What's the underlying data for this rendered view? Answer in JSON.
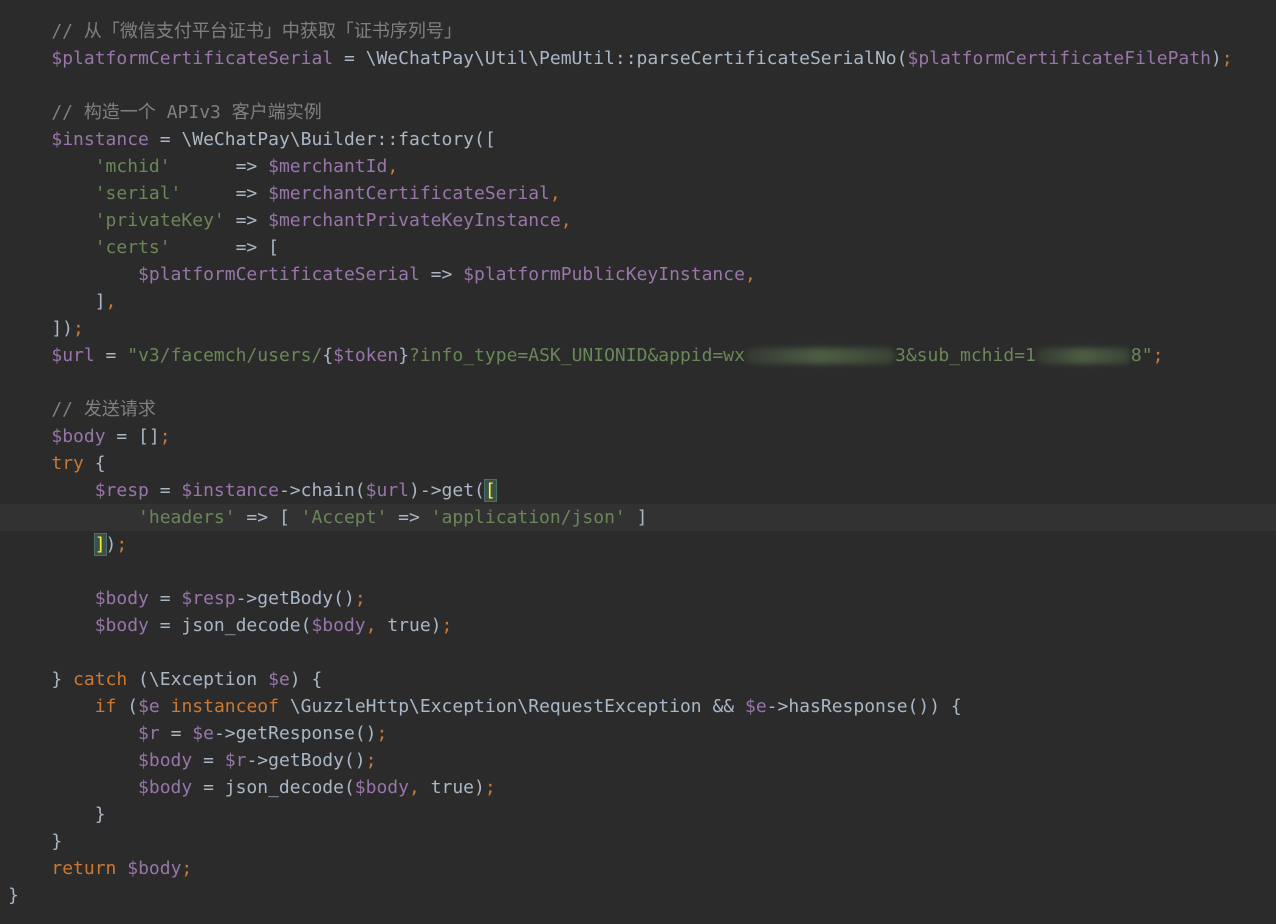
{
  "editor": {
    "theme_colors": {
      "background": "#2b2b2b",
      "current_line": "#323232",
      "comment": "#808080",
      "variable": "#9876aa",
      "string": "#6a8759",
      "keyword": "#cc7832",
      "plain": "#a9b7c6"
    },
    "current_line_index": 18,
    "lines": [
      [
        [
          "comment",
          "    // 从「微信支付平台证书」中获取「证书序列号」"
        ]
      ],
      [
        [
          "plain",
          "    "
        ],
        [
          "var",
          "$platformCertificateSerial"
        ],
        [
          "plain",
          " = \\WeChatPay\\Util\\PemUtil::parseCertificateSerialNo("
        ],
        [
          "var",
          "$platformCertificateFilePath"
        ],
        [
          "plain",
          ")"
        ],
        [
          "punct",
          ";"
        ]
      ],
      [],
      [
        [
          "comment",
          "    // 构造一个 APIv3 客户端实例"
        ]
      ],
      [
        [
          "plain",
          "    "
        ],
        [
          "var",
          "$instance"
        ],
        [
          "plain",
          " = \\WeChatPay\\Builder::factory(["
        ]
      ],
      [
        [
          "plain",
          "        "
        ],
        [
          "str",
          "'mchid'"
        ],
        [
          "plain",
          "      => "
        ],
        [
          "var",
          "$merchantId"
        ],
        [
          "punct",
          ","
        ]
      ],
      [
        [
          "plain",
          "        "
        ],
        [
          "str",
          "'serial'"
        ],
        [
          "plain",
          "     => "
        ],
        [
          "var",
          "$merchantCertificateSerial"
        ],
        [
          "punct",
          ","
        ]
      ],
      [
        [
          "plain",
          "        "
        ],
        [
          "str",
          "'privateKey'"
        ],
        [
          "plain",
          " => "
        ],
        [
          "var",
          "$merchantPrivateKeyInstance"
        ],
        [
          "punct",
          ","
        ]
      ],
      [
        [
          "plain",
          "        "
        ],
        [
          "str",
          "'certs'"
        ],
        [
          "plain",
          "      => ["
        ]
      ],
      [
        [
          "plain",
          "            "
        ],
        [
          "var",
          "$platformCertificateSerial"
        ],
        [
          "plain",
          " => "
        ],
        [
          "var",
          "$platformPublicKeyInstance"
        ],
        [
          "punct",
          ","
        ]
      ],
      [
        [
          "plain",
          "        ]"
        ],
        [
          "punct",
          ","
        ]
      ],
      [
        [
          "plain",
          "    ])"
        ],
        [
          "punct",
          ";"
        ]
      ],
      [
        [
          "plain",
          "    "
        ],
        [
          "var",
          "$url"
        ],
        [
          "plain",
          " = "
        ],
        [
          "str",
          "\"v3/facemch/users/"
        ],
        [
          "plain",
          "{"
        ],
        [
          "var",
          "$token"
        ],
        [
          "plain",
          "}"
        ],
        [
          "str",
          "?info_type=ASK_UNIONID&appid=wx"
        ],
        [
          "blur",
          "",
          150
        ],
        [
          "str",
          "3&sub_mchid=1"
        ],
        [
          "blur",
          "",
          95
        ],
        [
          "str",
          "8\""
        ],
        [
          "punct",
          ";"
        ]
      ],
      [],
      [
        [
          "comment",
          "    // 发送请求"
        ]
      ],
      [
        [
          "plain",
          "    "
        ],
        [
          "var",
          "$body"
        ],
        [
          "plain",
          " = []"
        ],
        [
          "punct",
          ";"
        ]
      ],
      [
        [
          "plain",
          "    "
        ],
        [
          "kw",
          "try"
        ],
        [
          "plain",
          " {"
        ]
      ],
      [
        [
          "plain",
          "        "
        ],
        [
          "var",
          "$resp"
        ],
        [
          "plain",
          " = "
        ],
        [
          "var",
          "$instance"
        ],
        [
          "plain",
          "->chain("
        ],
        [
          "var",
          "$url"
        ],
        [
          "plain",
          ")->get("
        ],
        [
          "match",
          "["
        ]
      ],
      [
        [
          "plain",
          "            "
        ],
        [
          "str",
          "'headers'"
        ],
        [
          "plain",
          " => [ "
        ],
        [
          "str",
          "'Accept'"
        ],
        [
          "plain",
          " => "
        ],
        [
          "str",
          "'application/json'"
        ],
        [
          "plain",
          " ]"
        ]
      ],
      [
        [
          "plain",
          "        "
        ],
        [
          "match",
          "]"
        ],
        [
          "plain",
          ")"
        ],
        [
          "punct",
          ";"
        ]
      ],
      [],
      [
        [
          "plain",
          "        "
        ],
        [
          "var",
          "$body"
        ],
        [
          "plain",
          " = "
        ],
        [
          "var",
          "$resp"
        ],
        [
          "plain",
          "->getBody()"
        ],
        [
          "punct",
          ";"
        ]
      ],
      [
        [
          "plain",
          "        "
        ],
        [
          "var",
          "$body"
        ],
        [
          "plain",
          " = json_decode("
        ],
        [
          "var",
          "$body"
        ],
        [
          "punct",
          ","
        ],
        [
          "plain",
          " true)"
        ],
        [
          "punct",
          ";"
        ]
      ],
      [],
      [
        [
          "plain",
          "    } "
        ],
        [
          "kw",
          "catch"
        ],
        [
          "plain",
          " (\\Exception "
        ],
        [
          "var",
          "$e"
        ],
        [
          "plain",
          ") {"
        ]
      ],
      [
        [
          "plain",
          "        "
        ],
        [
          "kw",
          "if"
        ],
        [
          "plain",
          " ("
        ],
        [
          "var",
          "$e"
        ],
        [
          "plain",
          " "
        ],
        [
          "kw",
          "instanceof"
        ],
        [
          "plain",
          " \\GuzzleHttp\\Exception\\RequestException && "
        ],
        [
          "var",
          "$e"
        ],
        [
          "plain",
          "->hasResponse()) {"
        ]
      ],
      [
        [
          "plain",
          "            "
        ],
        [
          "var",
          "$r"
        ],
        [
          "plain",
          " = "
        ],
        [
          "var",
          "$e"
        ],
        [
          "plain",
          "->getResponse()"
        ],
        [
          "punct",
          ";"
        ]
      ],
      [
        [
          "plain",
          "            "
        ],
        [
          "var",
          "$body"
        ],
        [
          "plain",
          " = "
        ],
        [
          "var",
          "$r"
        ],
        [
          "plain",
          "->getBody()"
        ],
        [
          "punct",
          ";"
        ]
      ],
      [
        [
          "plain",
          "            "
        ],
        [
          "var",
          "$body"
        ],
        [
          "plain",
          " = json_decode("
        ],
        [
          "var",
          "$body"
        ],
        [
          "punct",
          ","
        ],
        [
          "plain",
          " true)"
        ],
        [
          "punct",
          ";"
        ]
      ],
      [
        [
          "plain",
          "        }"
        ]
      ],
      [
        [
          "plain",
          "    }"
        ]
      ],
      [
        [
          "plain",
          "    "
        ],
        [
          "kw",
          "return"
        ],
        [
          "plain",
          " "
        ],
        [
          "var",
          "$body"
        ],
        [
          "punct",
          ";"
        ]
      ],
      [
        [
          "plain",
          "}"
        ]
      ]
    ]
  }
}
